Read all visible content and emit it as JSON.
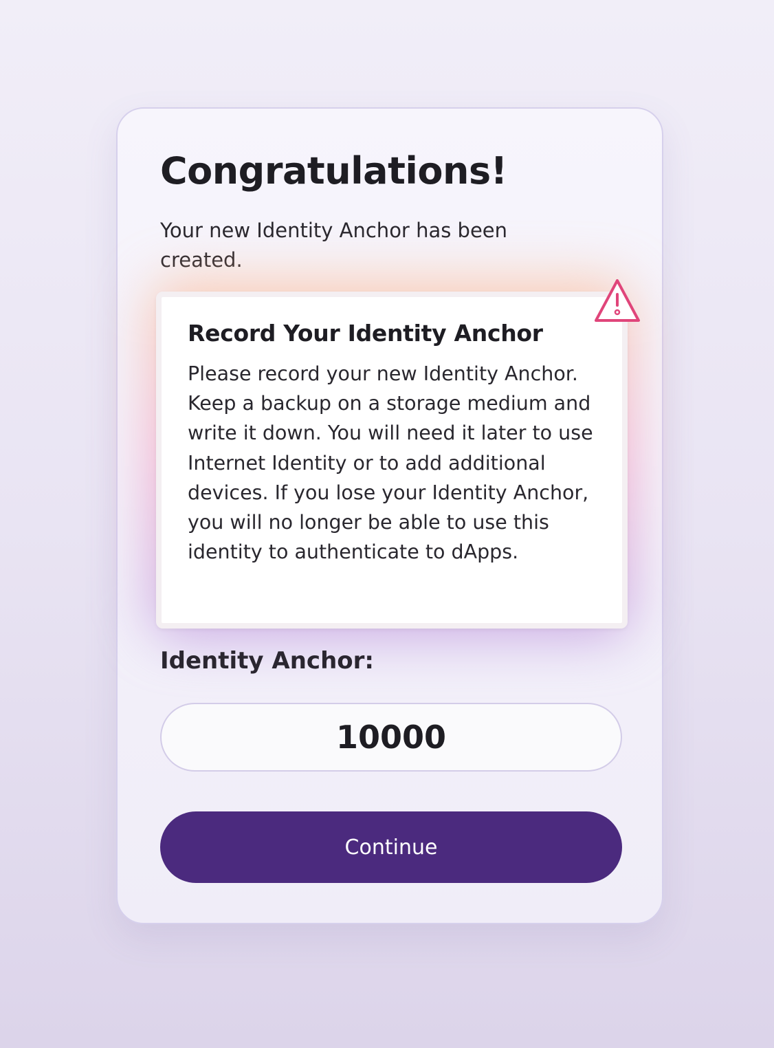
{
  "card": {
    "title": "Congratulations!",
    "subtitle": "Your new Identity Anchor has been created."
  },
  "warning": {
    "icon": "warning-triangle-icon",
    "title": "Record Your Identity Anchor",
    "text": "Please record your new Identity Anchor. Keep a backup on a storage medium and write it down. You will need it later to use Internet Identity or to add additional devices. If you lose your Identity Anchor, you will no longer be able to use this identity to authenticate to dApps."
  },
  "anchor": {
    "label": "Identity Anchor:",
    "value": "10000"
  },
  "actions": {
    "continue_label": "Continue"
  },
  "colors": {
    "primary_button": "#4b2a7e",
    "warning_icon": "#e0457a"
  }
}
